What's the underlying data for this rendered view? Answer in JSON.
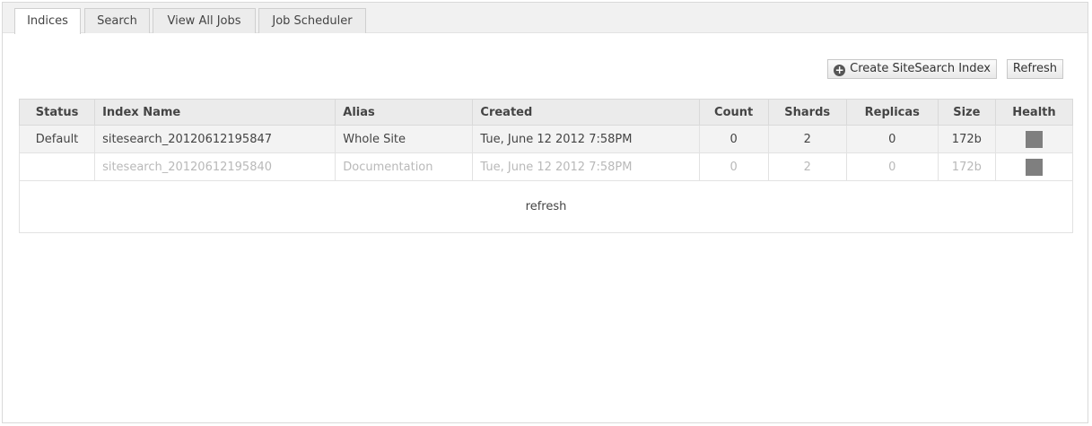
{
  "tabs": [
    {
      "label": "Indices",
      "active": true
    },
    {
      "label": "Search",
      "active": false
    },
    {
      "label": "View All Jobs",
      "active": false
    },
    {
      "label": "Job Scheduler",
      "active": false
    }
  ],
  "actions": {
    "create_label": "Create SiteSearch Index",
    "create_icon": "plus-circle-icon",
    "refresh_label": "Refresh"
  },
  "table": {
    "columns": [
      "Status",
      "Index Name",
      "Alias",
      "Created",
      "Count",
      "Shards",
      "Replicas",
      "Size",
      "Health"
    ],
    "rows": [
      {
        "status": "Default",
        "index_name": "sitesearch_20120612195847",
        "alias": "Whole Site",
        "created": "Tue, June 12 2012 7:58PM",
        "count": "0",
        "shards": "2",
        "replicas": "0",
        "size": "172b",
        "health_color": "#7f7f7f"
      },
      {
        "status": "",
        "index_name": "sitesearch_20120612195840",
        "alias": "Documentation",
        "created": "Tue, June 12 2012 7:58PM",
        "count": "0",
        "shards": "2",
        "replicas": "0",
        "size": "172b",
        "health_color": "#7f7f7f"
      }
    ],
    "refresh_link": "refresh"
  }
}
